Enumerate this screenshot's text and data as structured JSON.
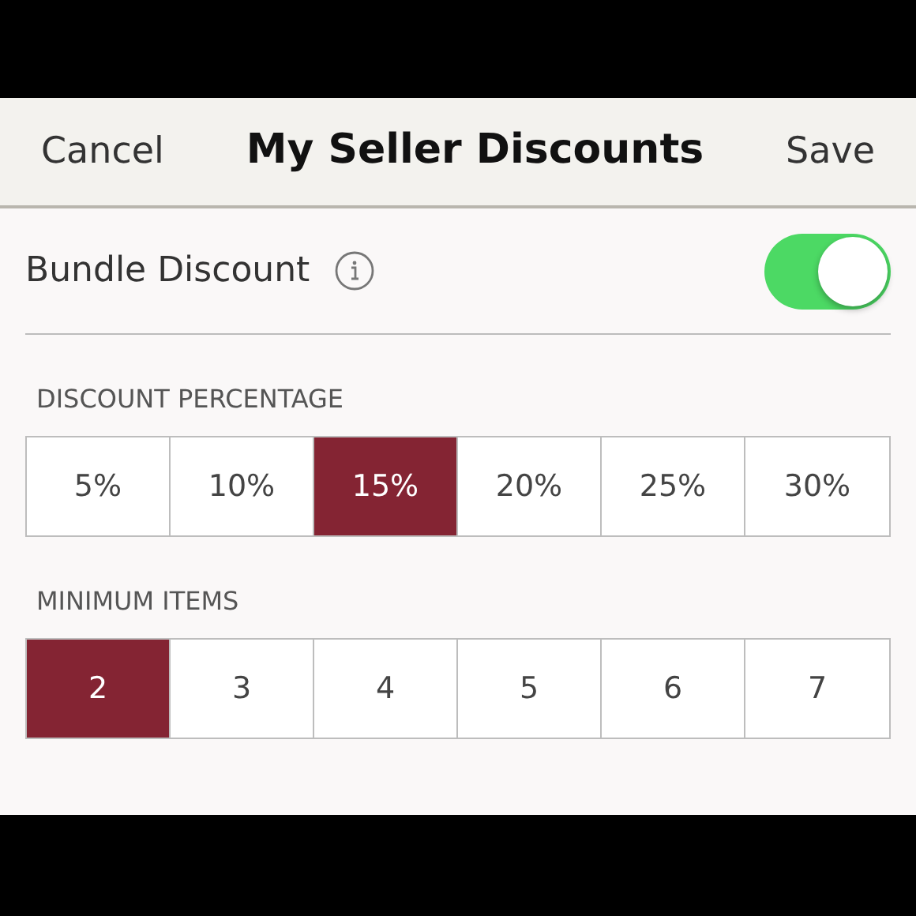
{
  "nav_bar": {
    "cancel": "Cancel",
    "title": "My Seller Discounts",
    "save": "Save"
  },
  "bundle_discount": {
    "label": "Bundle Discount",
    "on": true
  },
  "sections": [
    {
      "heading": "DISCOUNT PERCENTAGE",
      "options": [
        {
          "label": "5%",
          "selected": false
        },
        {
          "label": "10%",
          "selected": false
        },
        {
          "label": "15%",
          "selected": true
        },
        {
          "label": "20%",
          "selected": false
        },
        {
          "label": "25%",
          "selected": false
        },
        {
          "label": "30%",
          "selected": false
        }
      ]
    },
    {
      "heading": "MINIMUM ITEMS",
      "options": [
        {
          "label": "2",
          "selected": true
        },
        {
          "label": "3",
          "selected": false
        },
        {
          "label": "4",
          "selected": false
        },
        {
          "label": "5",
          "selected": false
        },
        {
          "label": "6",
          "selected": false
        },
        {
          "label": "7",
          "selected": false
        }
      ]
    }
  ]
}
